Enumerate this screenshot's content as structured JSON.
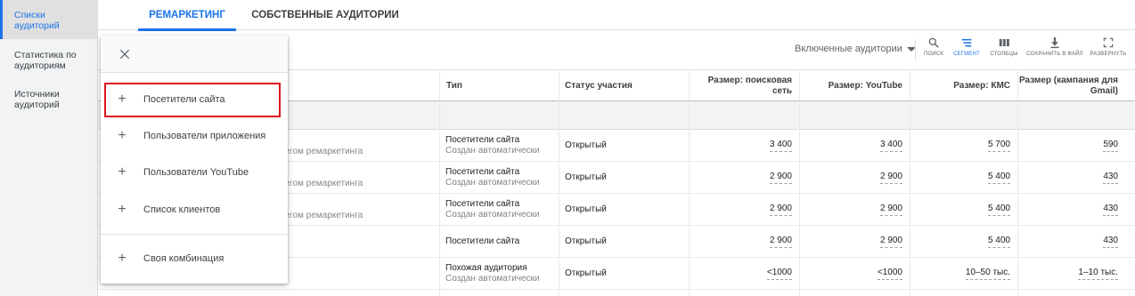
{
  "leftnav": {
    "items": [
      {
        "label": "Списки аудиторий",
        "active": true
      },
      {
        "label": "Статистика по аудиториям",
        "active": false
      },
      {
        "label": "Источники аудиторий",
        "active": false
      }
    ]
  },
  "tabs": [
    {
      "label": "РЕМАРКЕТИНГ",
      "active": true
    },
    {
      "label": "СОБСТВЕННЫЕ АУДИТОРИИ",
      "active": false
    }
  ],
  "toolbar": {
    "filter_label": "Включенные аудитории",
    "buttons": [
      {
        "label": "ПОИСК",
        "icon": "search-icon"
      },
      {
        "label": "СЕГМЕНТ",
        "icon": "segment-icon",
        "active": true
      },
      {
        "label": "СТОЛБЦЫ",
        "icon": "columns-icon"
      },
      {
        "label": "СОХРАНИТЬ В ФАЙЛ",
        "icon": "download-icon"
      },
      {
        "label": "РАЗВЕРНУТЬ",
        "icon": "expand-icon"
      }
    ]
  },
  "table": {
    "headers": {
      "type": "Тип",
      "status": "Статус участия",
      "search": "Размер: поисковая сеть",
      "youtube": "Размер: YouTube",
      "kms": "Размер: КМС",
      "gmail": "Размер (кампания для Gmail)"
    },
    "rows": [
      {
        "tag": "тегом ремаркетинга",
        "type": "Посетители сайта",
        "type_sub": "Создан автоматически",
        "status": "Открытый",
        "search": "3 400",
        "youtube": "3 400",
        "kms": "5 700",
        "gmail": "590"
      },
      {
        "tag": "тегом ремаркетинга",
        "type": "Посетители сайта",
        "type_sub": "Создан автоматически",
        "status": "Открытый",
        "search": "2 900",
        "youtube": "2 900",
        "kms": "5 400",
        "gmail": "430"
      },
      {
        "tag": "тегом ремаркетинга",
        "type": "Посетители сайта",
        "type_sub": "Создан автоматически",
        "status": "Открытый",
        "search": "2 900",
        "youtube": "2 900",
        "kms": "5 400",
        "gmail": "430"
      },
      {
        "tag": "",
        "type": "Посетители сайта",
        "type_sub": "",
        "status": "Открытый",
        "search": "2 900",
        "youtube": "2 900",
        "kms": "5 400",
        "gmail": "430"
      },
      {
        "tag": "",
        "type": "Похожая аудитория",
        "type_sub": "Создан автоматически",
        "status": "Открытый",
        "search": "<1000",
        "youtube": "<1000",
        "kms": "10–50 тыс.",
        "gmail": "1–10 тыс."
      }
    ]
  },
  "menu": {
    "items": [
      {
        "label": "Посетители сайта",
        "highlighted": true
      },
      {
        "label": "Пользователи приложения"
      },
      {
        "label": "Пользователи YouTube"
      },
      {
        "label": "Список клиентов"
      },
      {
        "label": "Своя комбинация"
      }
    ],
    "highlight_color": "#e0121b"
  },
  "colors": {
    "accent": "#1a73e8"
  }
}
